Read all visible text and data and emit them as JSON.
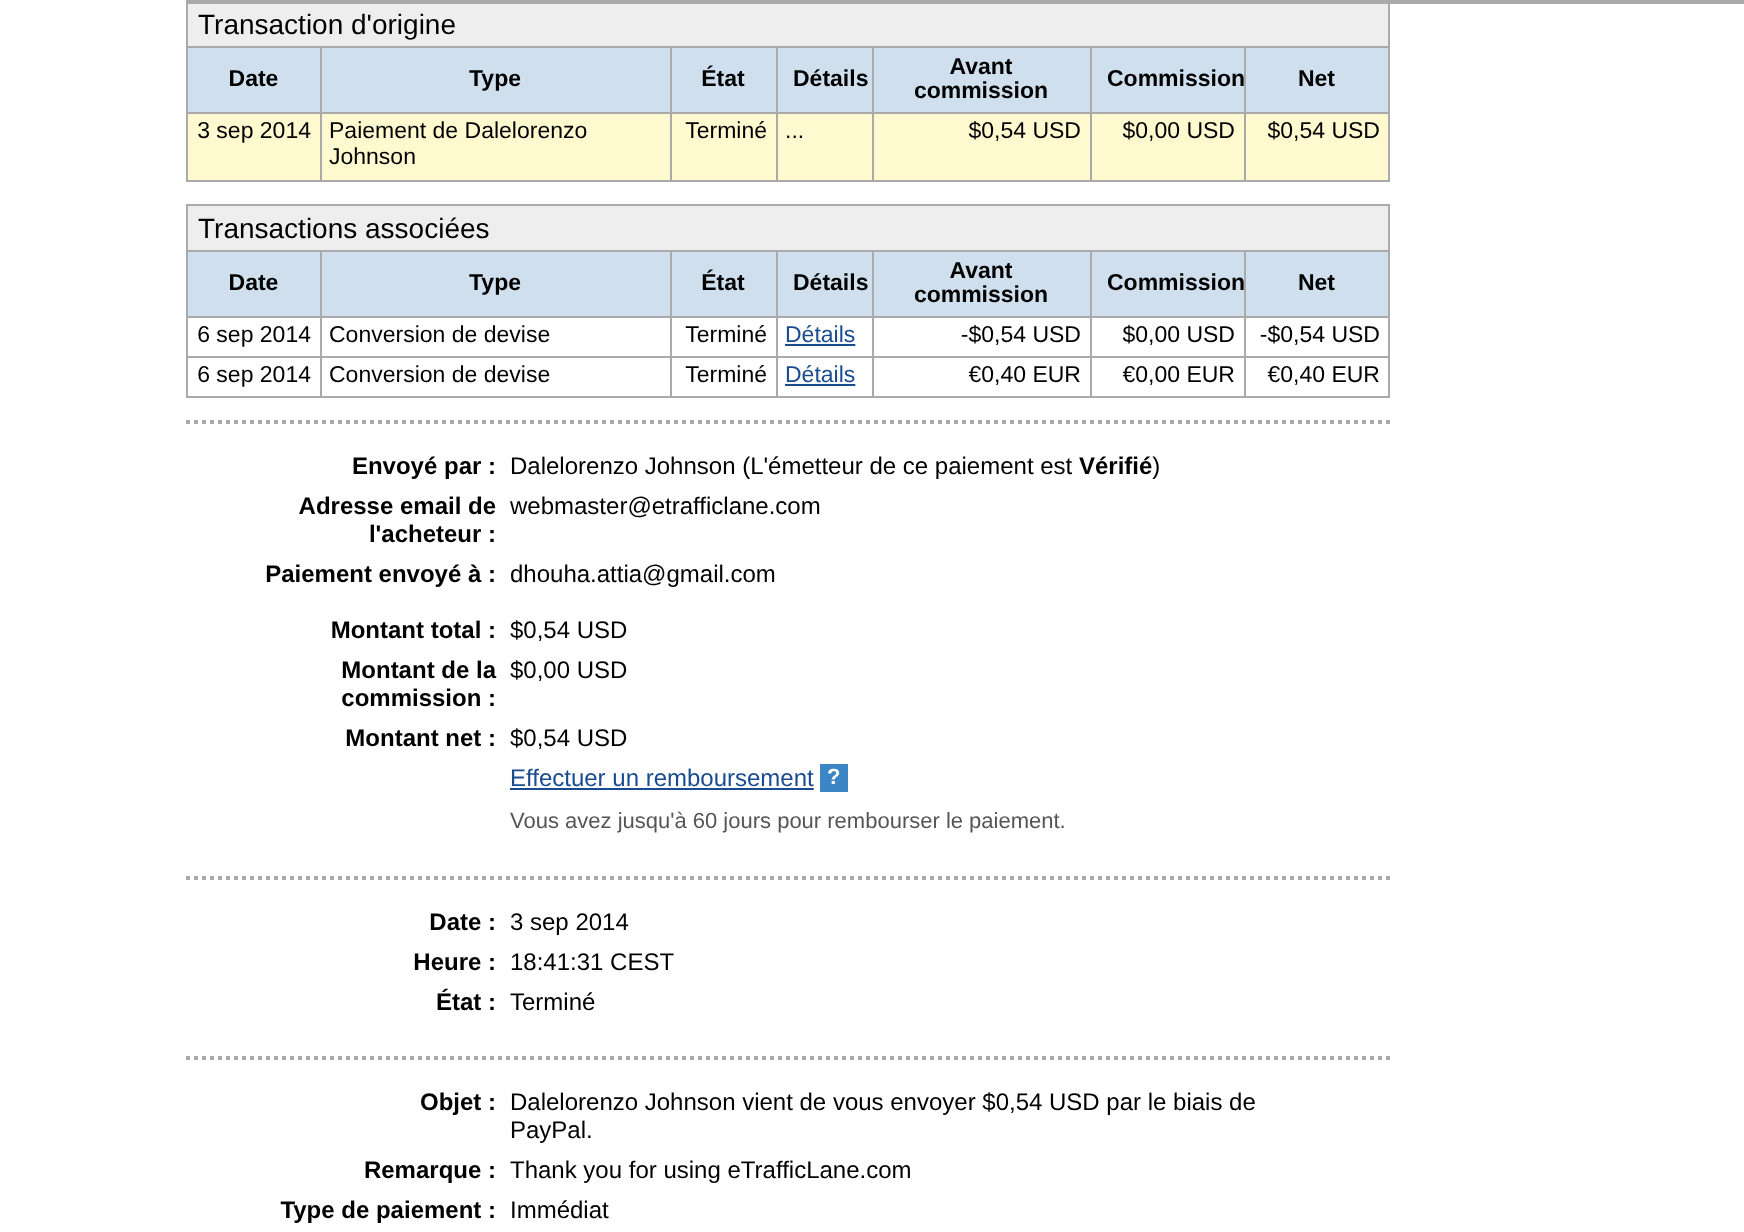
{
  "tables": [
    {
      "title": "Transaction d'origine",
      "columns": [
        "Date",
        "Type",
        "État",
        "Détails",
        "Avant commission",
        "Commission",
        "Net"
      ],
      "rows": [
        {
          "highlighted": true,
          "date": "3 sep 2014",
          "type": "Paiement de Dalelorenzo Johnson",
          "status": "Terminé",
          "details": "...",
          "details_link": false,
          "gross": "$0,54 USD",
          "fee": "$0,00 USD",
          "net": "$0,54 USD"
        }
      ]
    },
    {
      "title": "Transactions associées",
      "columns": [
        "Date",
        "Type",
        "État",
        "Détails",
        "Avant commission",
        "Commission",
        "Net"
      ],
      "rows": [
        {
          "highlighted": false,
          "date": "6 sep 2014",
          "type": "Conversion de devise",
          "status": "Terminé",
          "details": "Détails",
          "details_link": true,
          "gross": "-$0,54 USD",
          "fee": "$0,00 USD",
          "net": "-$0,54 USD"
        },
        {
          "highlighted": false,
          "date": "6 sep 2014",
          "type": "Conversion de devise",
          "status": "Terminé",
          "details": "Détails",
          "details_link": true,
          "gross": "€0,40 EUR",
          "fee": "€0,00 EUR",
          "net": "€0,40 EUR"
        }
      ]
    }
  ],
  "sections": [
    {
      "groups": [
        {
          "fields": [
            {
              "kind": "field",
              "label": "Envoyé par :",
              "value": "Dalelorenzo Johnson (L'émetteur de ce paiement est **Vérifié**)"
            },
            {
              "kind": "field",
              "label": "Adresse email de l'acheteur :",
              "value": "webmaster@etrafficlane.com"
            },
            {
              "kind": "field",
              "label": "Paiement envoyé à :",
              "value": "dhouha.attia@gmail.com"
            }
          ]
        },
        {
          "fields": [
            {
              "kind": "field",
              "label": "Montant total :",
              "value": "$0,54 USD"
            },
            {
              "kind": "field",
              "label": "Montant de la commission :",
              "value": "$0,00 USD"
            },
            {
              "kind": "field",
              "label": "Montant net :",
              "value": "$0,54 USD"
            },
            {
              "kind": "link",
              "value": "Effectuer un remboursement",
              "help": "?"
            },
            {
              "kind": "note",
              "value": "Vous avez jusqu'à 60 jours pour rembourser le paiement."
            }
          ]
        }
      ]
    },
    {
      "groups": [
        {
          "fields": [
            {
              "kind": "field",
              "label": "Date :",
              "value": "3 sep 2014"
            },
            {
              "kind": "field",
              "label": "Heure :",
              "value": "18:41:31 CEST"
            },
            {
              "kind": "field",
              "label": "État :",
              "value": "Terminé"
            }
          ]
        }
      ]
    },
    {
      "groups": [
        {
          "fields": [
            {
              "kind": "field",
              "label": "Objet :",
              "value": "Dalelorenzo Johnson vient de vous envoyer $0,54 USD par le biais de PayPal."
            },
            {
              "kind": "field",
              "label": "Remarque :",
              "value": "Thank you for using eTrafficLane.com"
            },
            {
              "kind": "field",
              "label": "Type de paiement :",
              "value": "Immédiat"
            }
          ]
        }
      ]
    }
  ]
}
